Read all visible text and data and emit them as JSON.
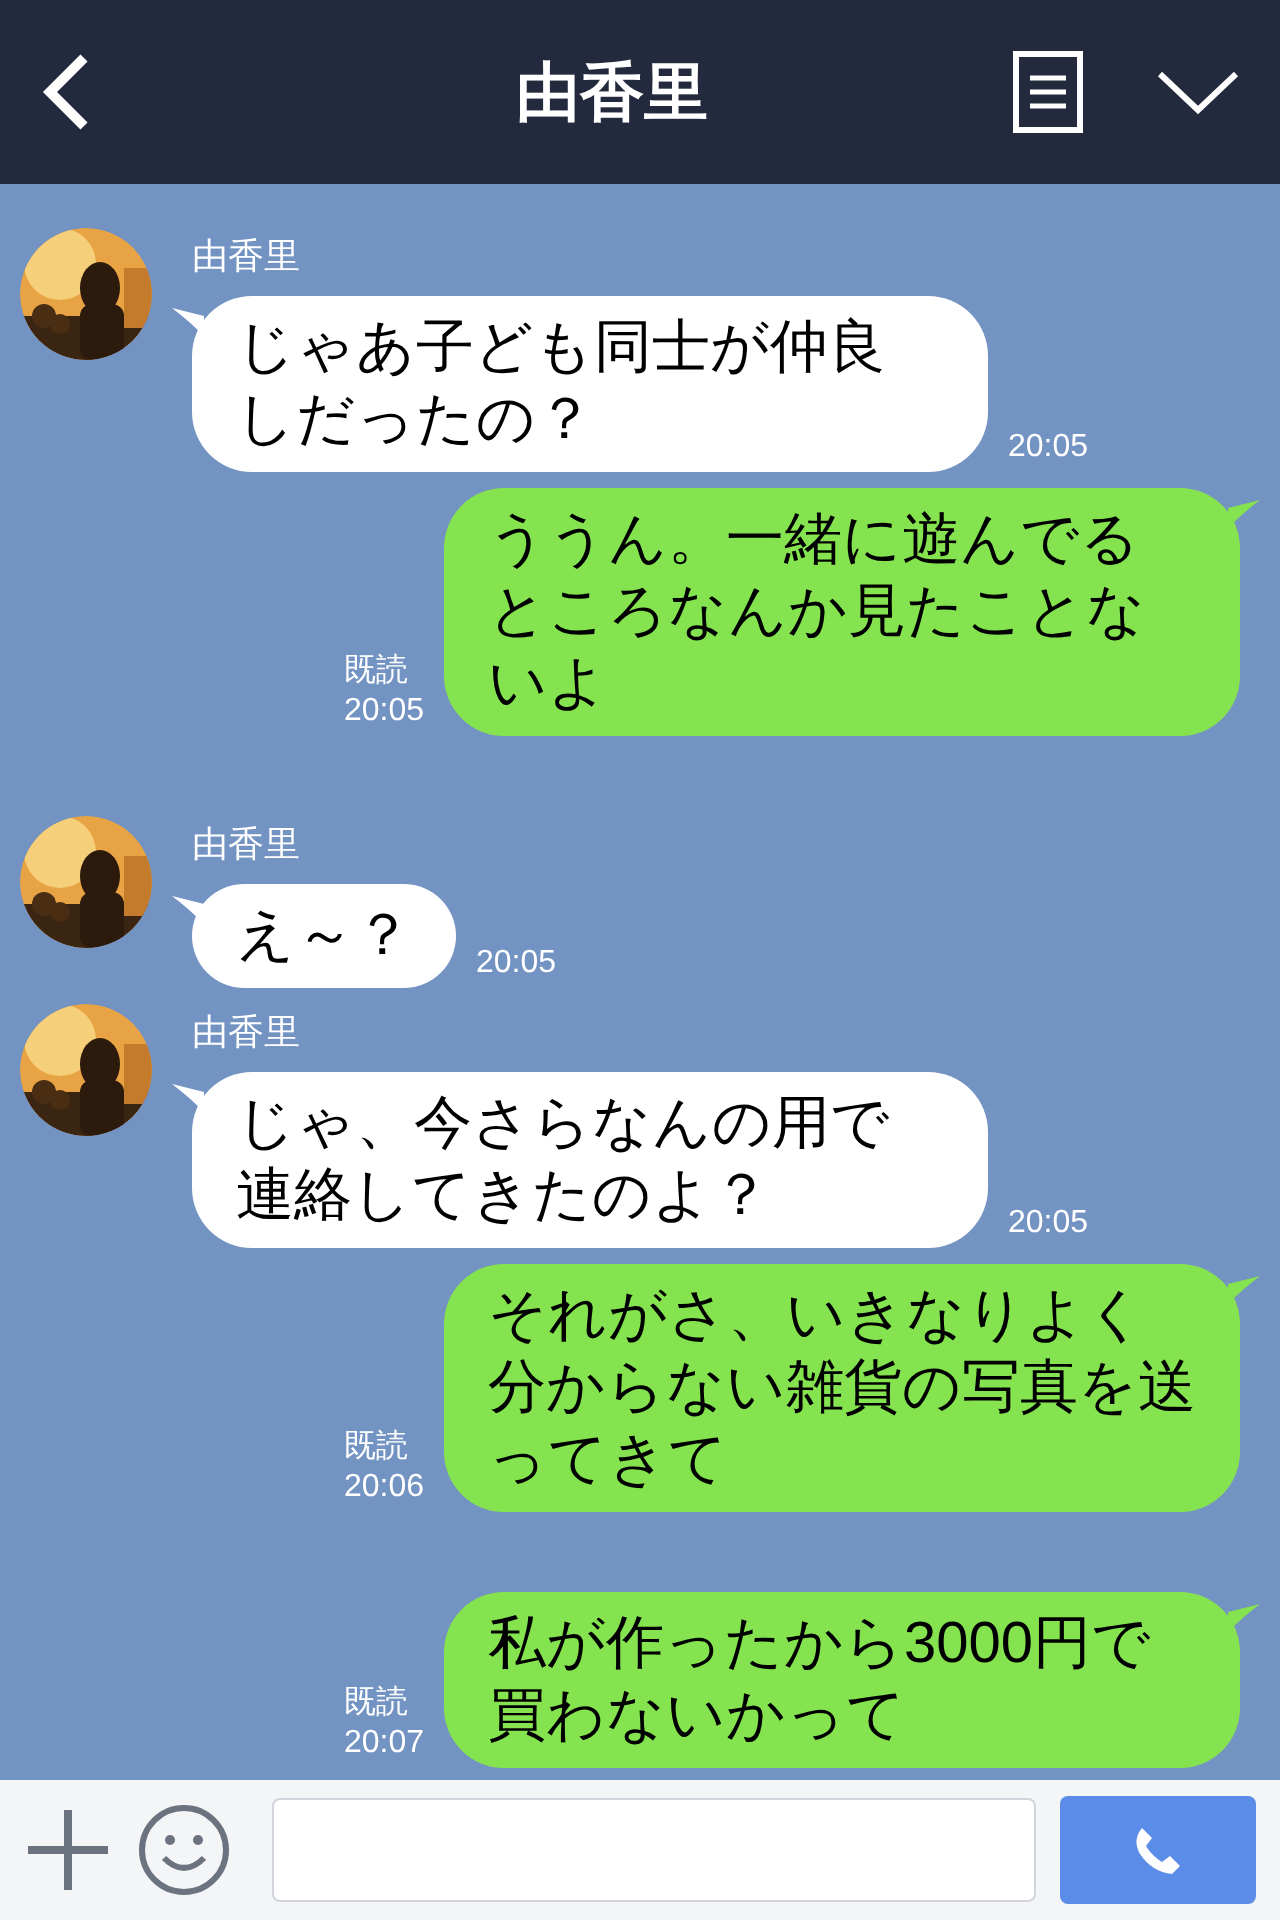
{
  "header": {
    "title": "由香里"
  },
  "messages": [
    {
      "kind": "incoming",
      "sender": "由香里",
      "text": "じゃあ子ども同士が仲良しだったの？",
      "time": "20:05"
    },
    {
      "kind": "outgoing",
      "read": "既読",
      "text": "ううん。一緒に遊んでるところなんか見たことないよ",
      "time": "20:05"
    },
    {
      "kind": "incoming",
      "sender": "由香里",
      "text": "え～？",
      "time": "20:05"
    },
    {
      "kind": "incoming",
      "sender": "由香里",
      "text": "じゃ、今さらなんの用で連絡してきたのよ？",
      "time": "20:05"
    },
    {
      "kind": "outgoing",
      "read": "既読",
      "text": "それがさ、いきなりよく分からない雑貨の写真を送ってきて",
      "time": "20:06"
    },
    {
      "kind": "outgoing",
      "read": "既読",
      "text": "私が作ったから3000円で買わないかって",
      "time": "20:07"
    }
  ]
}
